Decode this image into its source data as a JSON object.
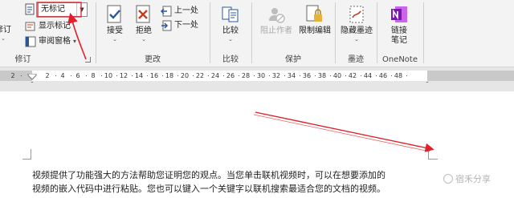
{
  "ribbon": {
    "revisions": {
      "track_changes_label": "修订",
      "markup_select_value": "无标记",
      "show_markup_label": "显示标记",
      "reviewing_pane_label": "审阅窗格",
      "group_label": "修订"
    },
    "changes": {
      "accept_label": "接受",
      "reject_label": "拒绝",
      "previous_label": "上一处",
      "next_label": "下一处",
      "group_label": "更改"
    },
    "compare": {
      "compare_label": "比较",
      "group_label": "比较"
    },
    "protect": {
      "block_authors_label": "阻止作者",
      "restrict_editing_label": "限制编辑",
      "group_label": "保护"
    },
    "ink": {
      "hide_ink_label": "隐藏墨迹",
      "group_label": "墨迹"
    },
    "onenote": {
      "linked_notes_label": "链接笔记",
      "group_label": "OneNote"
    }
  },
  "ruler": {
    "labels": [
      "2",
      "2",
      "4",
      "6",
      "8",
      "10",
      "12",
      "14",
      "16",
      "18",
      "20",
      "22",
      "24",
      "26",
      "28",
      "30",
      "32",
      "34",
      "36",
      "38",
      "40",
      "42",
      "44",
      "46",
      "48"
    ]
  },
  "document": {
    "lines": [
      "视频提供了功能强大的方法帮助您证明您的观点。当您单击联机视频时，可以在想要添加的",
      "视频的嵌入代码中进行粘贴。您也可以键入一个关键字以联机搜索最适合您的文档的视频。"
    ]
  },
  "watermark": {
    "text": "宿禾分享"
  },
  "colors": {
    "accent": "#2b579a",
    "annotation_arrow": "#e0202a",
    "onenote": "#7719aa",
    "reject": "#c43e1c"
  }
}
